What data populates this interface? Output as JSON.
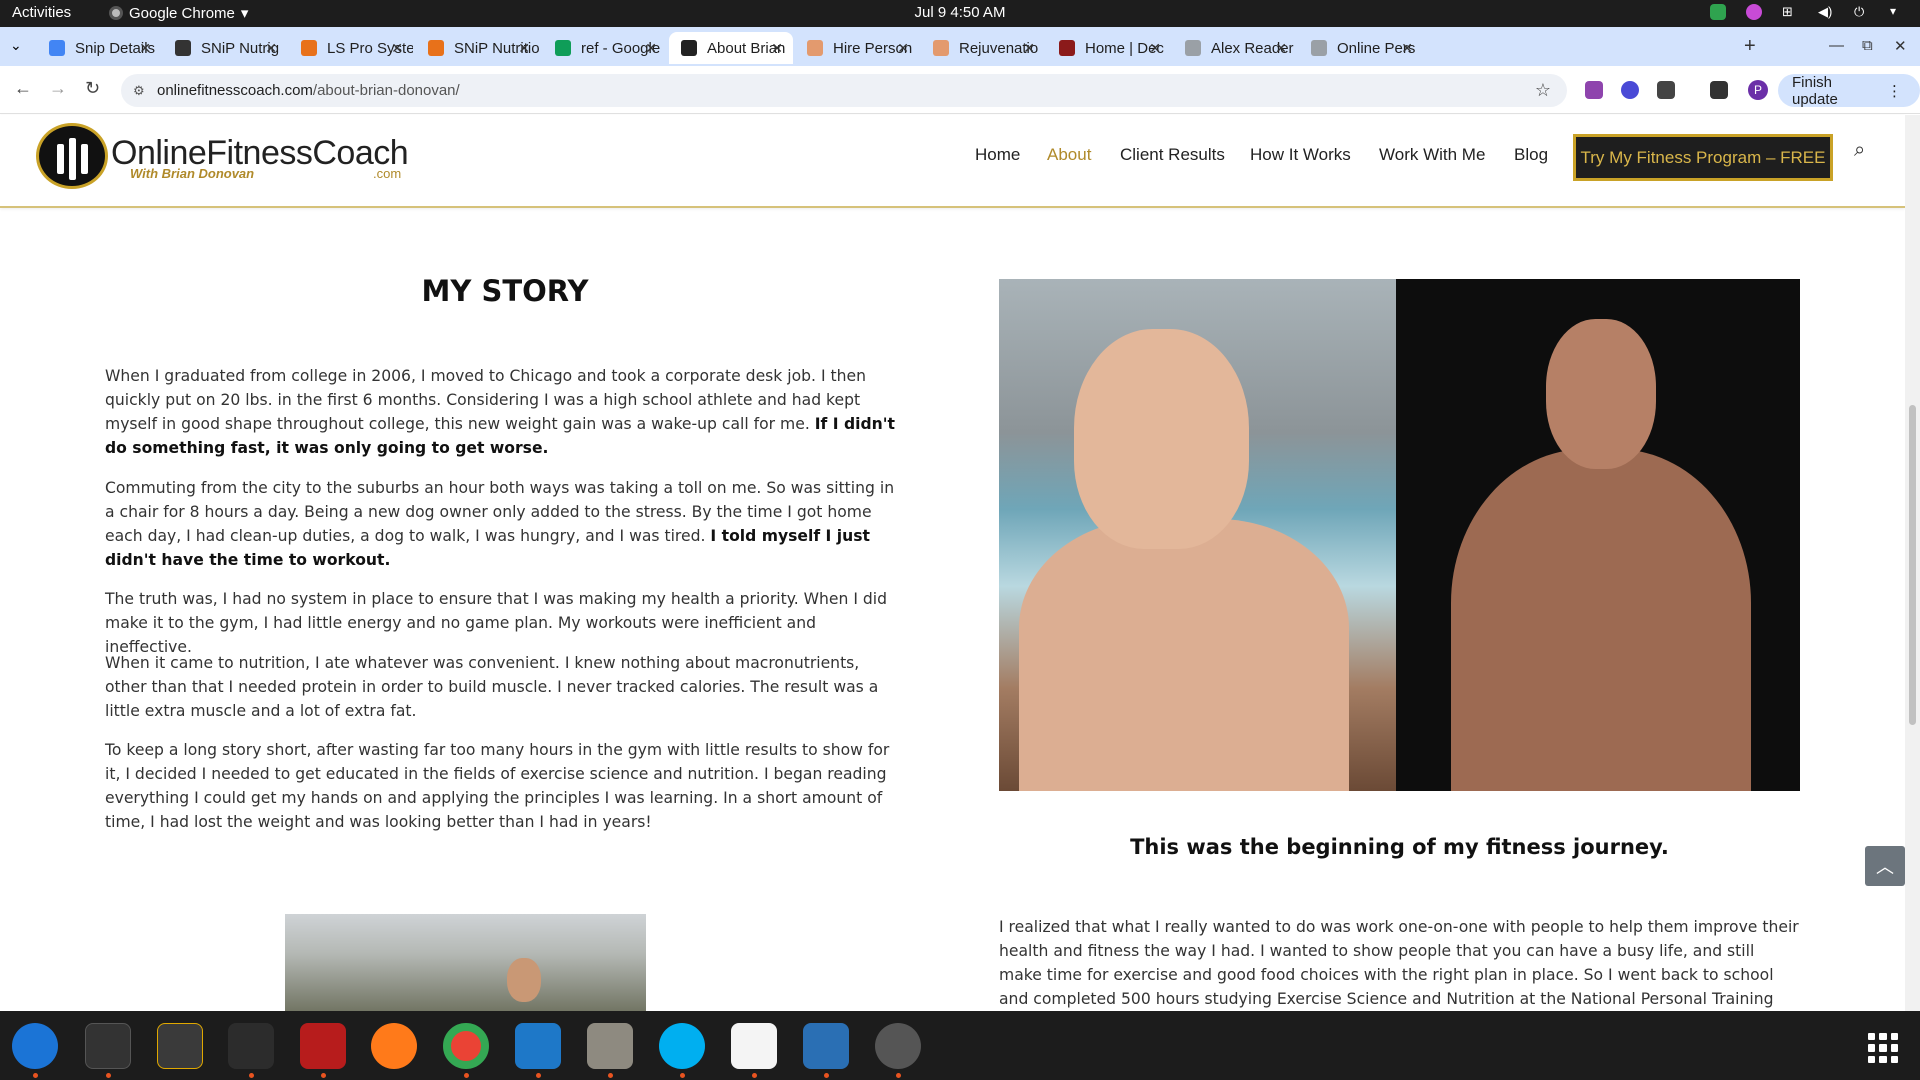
{
  "os": {
    "activities": "Activities",
    "app_name": "Google Chrome",
    "clock": "Jul 9  4:50 AM"
  },
  "browser": {
    "tabs": [
      {
        "title": "Snip Details",
        "color": "#4285f4"
      },
      {
        "title": "SNiP Nutrig",
        "color": "#333333"
      },
      {
        "title": "LS Pro Syste",
        "color": "#e8711a"
      },
      {
        "title": "SNiP Nutritio",
        "color": "#e8711a"
      },
      {
        "title": "ref - Google",
        "color": "#0f9d58"
      },
      {
        "title": "About Brian",
        "color": "#222222"
      },
      {
        "title": "Hire Person",
        "color": "#e39a6e"
      },
      {
        "title": "Rejuvenatio",
        "color": "#e39a6e"
      },
      {
        "title": "Home | Dec",
        "color": "#8b1a1a"
      },
      {
        "title": "Alex Reader",
        "color": "#9aa0a6"
      },
      {
        "title": "Online Pers",
        "color": "#9aa0a6"
      }
    ],
    "active_tab_index": 5,
    "url_host": "onlinefitnesscoach.com",
    "url_path": "/about-brian-donovan/",
    "finish_update": "Finish update",
    "profile_initial": "P"
  },
  "site": {
    "logo_title": "OnlineFitnessCoach",
    "logo_subtitle": "With Brian Donovan",
    "logo_com": ".com",
    "nav": [
      {
        "label": "Home",
        "active": false
      },
      {
        "label": "About",
        "active": true
      },
      {
        "label": "Client Results",
        "active": false
      },
      {
        "label": "How It Works",
        "active": false
      },
      {
        "label": "Work With Me",
        "active": false
      },
      {
        "label": "Blog",
        "active": false
      }
    ],
    "cta": "Try My Fitness Program – FREE",
    "accent_color": "#c9a227"
  },
  "story": {
    "title": "MY STORY",
    "p1_normal": "When I graduated from college in 2006, I moved to Chicago and took a corporate desk job. I then quickly put on 20 lbs. in the first 6 months. Considering I was a high school athlete and had kept myself in good shape throughout college, this new weight gain was a wake-up call for me. ",
    "p1_bold": "If I didn't do something fast, it was only going to get worse.",
    "p2_normal": "Commuting from the city to the suburbs an hour both ways was taking a toll on me. So was sitting in a chair for 8 hours a day. Being a new dog owner only added to the stress. By the time I got home each day, I had clean-up duties, a dog to walk, I was hungry, and I was tired. ",
    "p2_bold": "I told myself I just didn't have the time to workout.",
    "p3": "The truth was, I had no system in place to ensure that I was making my health a priority. When I did make it to the gym, I had little energy and no game plan. My workouts were inefficient and ineffective.",
    "p4": "When it came to nutrition, I ate whatever was convenient. I knew nothing about macronutrients, other than that I needed protein in order to build muscle. I never tracked calories. The result was a little extra muscle and a lot of extra fat.",
    "p5": "To keep a long story short, after wasting far too many hours in the gym with little results to show for it, I decided I needed to get educated in the fields of exercise science and nutrition. I began reading everything I could get my hands on and applying the principles I was learning. In a short amount of time, I had lost the weight and was looking better than I had in years!",
    "caption": "This was the beginning of my fitness journey.",
    "p6": "I realized that what I really wanted to do was work one-on-one with people to help them improve their health and fitness the way I had. I wanted to show people that you can have a busy life, and still make time for exercise and good food choices with the right plan in place. So I went back to school and completed 500 hours studying Exercise Science and Nutrition at the National Personal Training Institute in Chicago, and"
  }
}
